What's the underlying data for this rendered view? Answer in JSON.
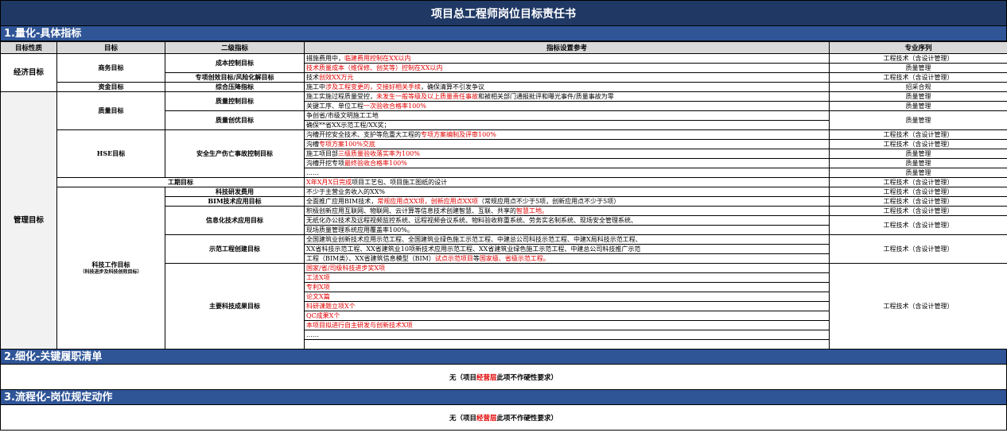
{
  "doc_title": "项目总工程师岗位目标责任书",
  "sections": {
    "s1": "1.量化-具体指标",
    "s2": "2.细化-关键履职清单",
    "s3": "3.流程化-岗位规定动作"
  },
  "headers": {
    "nature": "目标性质",
    "goal": "目标",
    "level2": "二级指标",
    "reference": "指标设置参考",
    "sequence": "专业序列"
  },
  "categories": {
    "economic": "经济目标",
    "management": "管理目标"
  },
  "goals": {
    "business": "商务目标",
    "capital": "资金目标",
    "quality": "质量目标",
    "hse": "HSE目标",
    "schedule": "工期目标",
    "tech": "科技工作目标",
    "tech_sub": "（科技进步及科技创效目标）"
  },
  "level2": {
    "cost": "成本控制目标",
    "special": "专项创效目标/风险化解目标",
    "pressure": "综合压降指标",
    "qctrl": "质量控制目标",
    "qexcel": "质量创优目标",
    "safety": "安全生产伤亡事故控制目标",
    "rd": "科技研发费用",
    "bim": "BIM技术应用目标",
    "info": "信息化技术应用目标",
    "demo": "示范工程创建目标",
    "achieve": "主要科技成果目标"
  },
  "refs": {
    "r1a": "措施费用中，",
    "r1b": "临建费用控制在XX以内",
    "r2": "技术质量成本（维保修、创奖等）控制在XX以内",
    "r3a": "技术",
    "r3b": "创效XX万元",
    "r4a": "施工中",
    "r4b": "涉及工程变更的，交接好相关手续",
    "r4c": "，确保清算不引发争议",
    "r5a": "施工实施过程质量受控，",
    "r5b": "未发生一般等级及以上质量责任事故",
    "r5c": "和被相关部门通报批评和曝光事件/质量事故为零",
    "r6a": "关键工序、单位工程",
    "r6b": "一次验收合格率100%",
    "r7": "争创省/市级文明施工工地",
    "r8": "确保**省XX示范工程/XX奖；",
    "r9a": "沟槽开挖安全技术、支护等危重大工程的",
    "r9b": "专项方案编制及评审100%",
    "r10a": "沟槽",
    "r10b": "专项方案100%交底",
    "r11a": "施工项目部",
    "r11b": "三级质量验收落实率为100%",
    "r12a": "沟槽开挖专项",
    "r12b": "最终验收合格率100%",
    "r13": "……",
    "r14a": "X年X月X日完成",
    "r14b": "项目工艺包、项目施工图纸的设计",
    "r15": "不少于主营业务收入的XX%",
    "r16a": "全面推广应用BIM技术，",
    "r16b": "常规应用点XX项，创新应用点XX项",
    "r16c": "（常规应用点不少于5项，创新应用点不少于5项）",
    "r17a": "积极创新应用互联网、物联网、云计算等信息技术创建智慧、互联、共享的",
    "r17b": "智慧工地。",
    "r18a": "无纸化办公技术及远程视频监控系统、远程视频会议系统、物料验收称重系统、劳务实名制系统、现场安全管理系统、",
    "r18b": "现场质量管理系统应用覆盖率100%。",
    "r19a": "全国建筑业创新技术应用示范工程、全国建筑业绿色施工示范工程、中建总公司科技示范工程、中建X局科技示范工程、",
    "r19b": "XX省科技示范工程、XX省建筑业10项新技术应用示范工程、XX省建筑业绿色施工示范工程、中建总公司科技推广示范",
    "r19c1": "工程（BIM类）、XX省建筑信息模型（BIM）",
    "r19c2": "试点示范项目",
    "r19c3": "等",
    "r19c4": "国家级、省级示范工程。",
    "r20": "国家/省/司级科技进步奖X项",
    "r21": "工法X项",
    "r22": "专利X项",
    "r23": "论文X篇",
    "r24": "科研课题立项X个",
    "r25": "QC成果X个",
    "r26": "本项目拟进行自主研发与创新技术X项",
    "r27": "……"
  },
  "seq": {
    "eng": "工程技术（含设计管理）",
    "qm": "质量管理",
    "tender": "招采合规"
  },
  "none_note": {
    "pre": "无（项目",
    "red": "经营层",
    "post": "此项不作硬性要求）"
  }
}
